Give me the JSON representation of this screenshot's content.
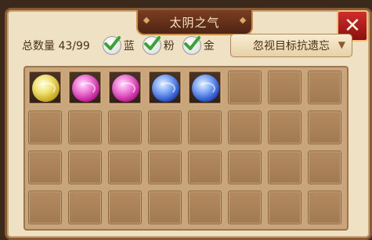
{
  "window": {
    "title": "太阴之气",
    "close_symbol": "✕"
  },
  "toolbar": {
    "count_label": "总数量 43/99",
    "filters": [
      {
        "label": "蓝",
        "checked": true
      },
      {
        "label": "粉",
        "checked": true
      },
      {
        "label": "金",
        "checked": true
      }
    ],
    "dropdown_value": "忽视目标抗遗忘"
  },
  "inventory": {
    "slots": [
      {
        "item": "gold-orb"
      },
      {
        "item": "pink-orb"
      },
      {
        "item": "pink-orb"
      },
      {
        "item": "blue-orb"
      },
      {
        "item": "blue-orb"
      },
      {
        "item": ""
      },
      {
        "item": ""
      },
      {
        "item": ""
      }
    ]
  },
  "colors": {
    "accent": "#8a5a34",
    "check": "#3aa336",
    "close": "#c21d1d"
  }
}
